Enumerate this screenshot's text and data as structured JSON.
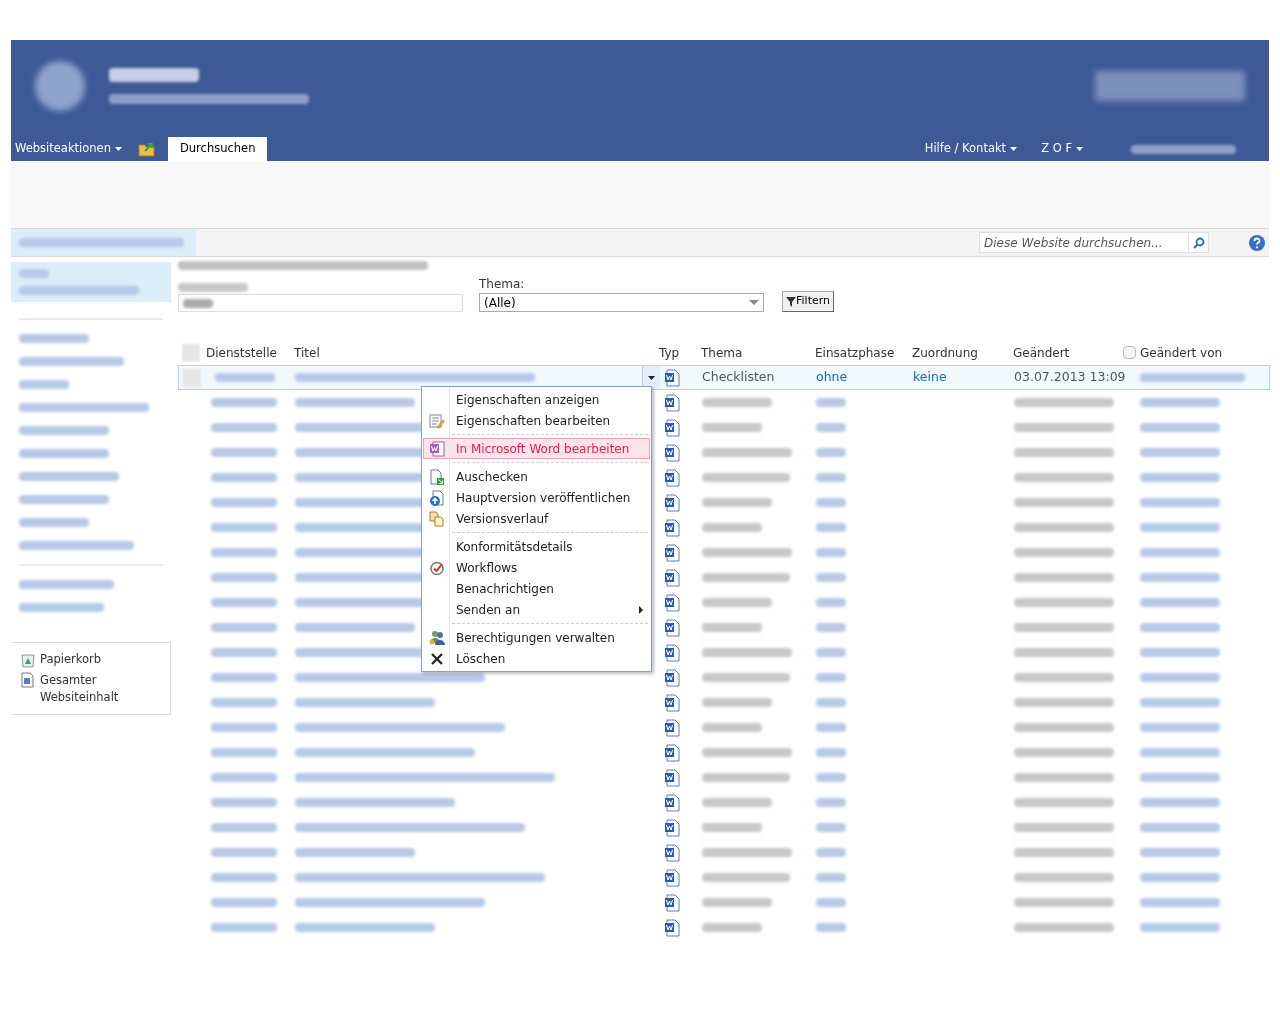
{
  "top_nav": {
    "site_actions": "Websiteaktionen",
    "tabs": [
      {
        "label": "Durchsuchen",
        "selected": true
      }
    ],
    "links": [
      "Hilfe / Kontakt",
      "Z O F"
    ]
  },
  "search": {
    "placeholder": "Diese Website durchsuchen..."
  },
  "quick_launch": {
    "footer": [
      "Papierkorb",
      "Gesamter Websiteinhalt"
    ]
  },
  "filters": [
    {
      "label": "Thema:",
      "value": "(Alle)"
    }
  ],
  "filter_button": "Filtern",
  "table": {
    "select_all": {
      "checked": false
    },
    "modified_by_checkbox": {
      "checked": false
    },
    "columns": [
      "Dienststelle",
      "Titel",
      "Typ",
      "Thema",
      "Einsatzphase",
      "Zuordnung",
      "Geändert",
      "Geändert von"
    ],
    "rows": [
      {
        "kind": "open",
        "checked": false,
        "thema": "Checklisten",
        "einsatzphase": "ohne",
        "zuordnung": "keine",
        "geaendert": "03.07.2013 13:09"
      },
      {
        "kind": "blurred"
      },
      {
        "kind": "blurred"
      },
      {
        "kind": "blurred"
      },
      {
        "kind": "blurred"
      },
      {
        "kind": "blurred"
      },
      {
        "kind": "blurred"
      },
      {
        "kind": "blurred"
      },
      {
        "kind": "blurred"
      },
      {
        "kind": "blurred"
      },
      {
        "kind": "blurred"
      },
      {
        "kind": "blurred"
      },
      {
        "kind": "blurred"
      },
      {
        "kind": "blurred"
      },
      {
        "kind": "blurred"
      },
      {
        "kind": "blurred"
      },
      {
        "kind": "blurred"
      },
      {
        "kind": "blurred"
      },
      {
        "kind": "blurred"
      },
      {
        "kind": "blurred"
      },
      {
        "kind": "blurred"
      },
      {
        "kind": "blurred"
      },
      {
        "kind": "blurred"
      }
    ]
  },
  "context_menu": [
    {
      "label": "Eigenschaften anzeigen",
      "selected": false,
      "separator_before": false,
      "submenu": false
    },
    {
      "label": "Eigenschaften bearbeiten",
      "selected": false,
      "separator_before": false,
      "submenu": false
    },
    {
      "label": "In Microsoft Word bearbeiten",
      "selected": true,
      "separator_before": true,
      "submenu": false
    },
    {
      "label": "Auschecken",
      "selected": false,
      "separator_before": true,
      "submenu": false
    },
    {
      "label": "Hauptversion veröffentlichen",
      "selected": false,
      "separator_before": false,
      "submenu": false
    },
    {
      "label": "Versionsverlauf",
      "selected": false,
      "separator_before": false,
      "submenu": false
    },
    {
      "label": "Konformitätsdetails",
      "selected": false,
      "separator_before": true,
      "submenu": false
    },
    {
      "label": "Workflows",
      "selected": false,
      "separator_before": false,
      "submenu": false
    },
    {
      "label": "Benachrichtigen",
      "selected": false,
      "separator_before": false,
      "submenu": false
    },
    {
      "label": "Senden an",
      "selected": false,
      "separator_before": false,
      "submenu": true
    },
    {
      "label": "Berechtigungen verwalten",
      "selected": false,
      "separator_before": true,
      "submenu": false
    },
    {
      "label": "Löschen",
      "selected": false,
      "separator_before": false,
      "submenu": false
    }
  ]
}
